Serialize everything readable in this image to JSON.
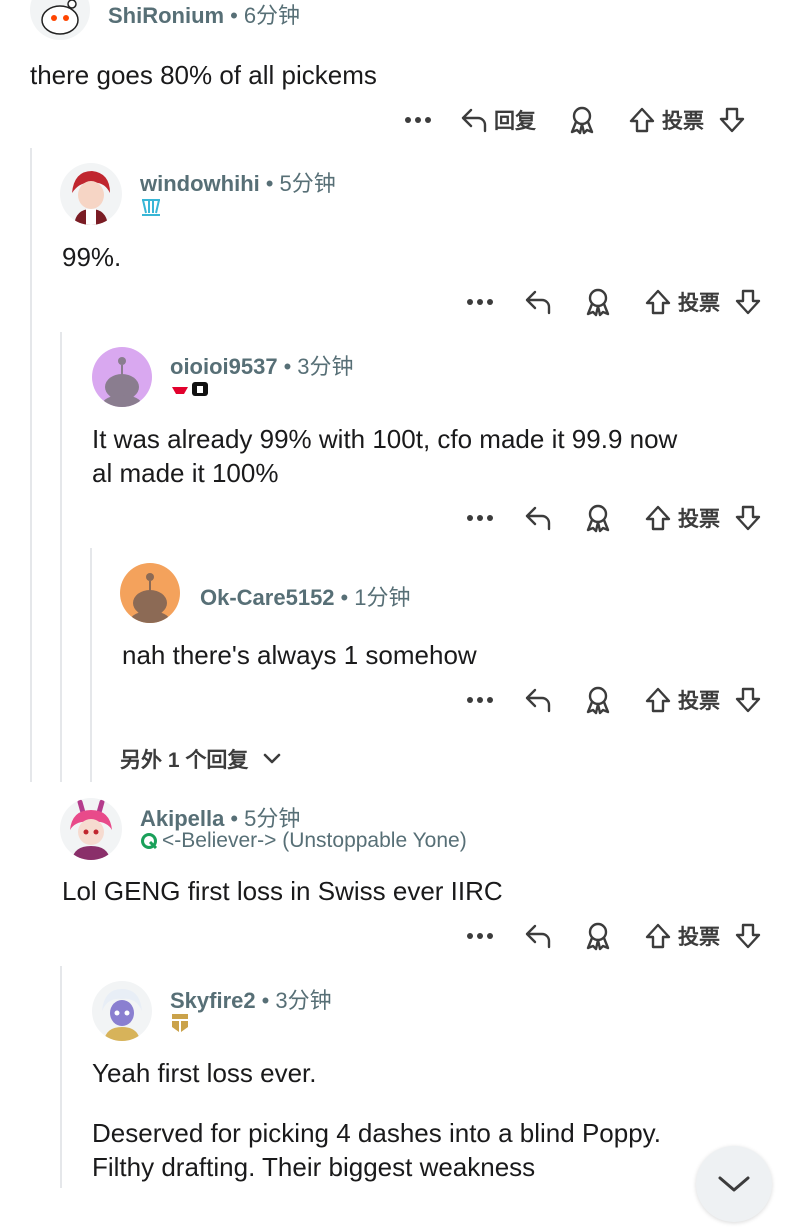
{
  "comments": [
    {
      "username": "ShiRonium",
      "time": "6分钟",
      "body": [
        "there goes 80% of all pickems"
      ],
      "reply_label": "回复",
      "vote_label": "投票"
    },
    {
      "username": "windowhihi",
      "time": "5分钟",
      "flair": "",
      "body": [
        "99%."
      ],
      "vote_label": "投票"
    },
    {
      "username": "oioioi9537",
      "time": "3分钟",
      "body": [
        "It was already 99% with 100t, cfo made it 99.9 now",
        "al made it 100%"
      ],
      "vote_label": "投票"
    },
    {
      "username": "Ok-Care5152",
      "time": "1分钟",
      "body": [
        "nah there's always 1 somehow"
      ],
      "vote_label": "投票"
    },
    {
      "username": "Akipella",
      "time": "5分钟",
      "flair": "<-Believer-> (Unstoppable Yone)",
      "body": [
        "Lol GENG first loss in Swiss ever IIRC"
      ],
      "vote_label": "投票"
    },
    {
      "username": "Skyfire2",
      "time": "3分钟",
      "body": [
        "Yeah first loss ever.",
        "Deserved for picking 4 dashes into a blind Poppy.",
        "Filthy drafting. Their biggest weakness"
      ]
    }
  ],
  "more_replies": "另外 1 个回复",
  "colors": {
    "meta": "#576f76",
    "text": "#1a1a1b",
    "line": "#e5e7ea"
  }
}
